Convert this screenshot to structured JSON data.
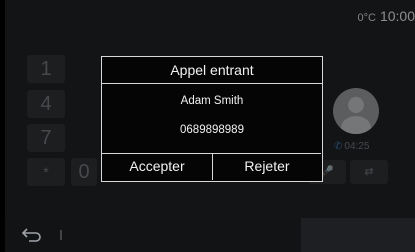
{
  "status": {
    "temperature": "0°C",
    "time": "10:00"
  },
  "keypad": {
    "keys": [
      "1",
      "4",
      "7",
      "*",
      "0"
    ]
  },
  "contact": {
    "call_duration": "04:25"
  },
  "dialog": {
    "title": "Appel entrant",
    "caller_name": "Adam Smith",
    "caller_number": "0689898989",
    "accept_label": "Accepter",
    "reject_label": "Rejeter"
  },
  "icons": {
    "back": "back-icon",
    "microphone": "microphone-icon",
    "transfer": "phone-transfer-icon",
    "phone": "phone-icon",
    "avatar": "contact-avatar-icon"
  }
}
